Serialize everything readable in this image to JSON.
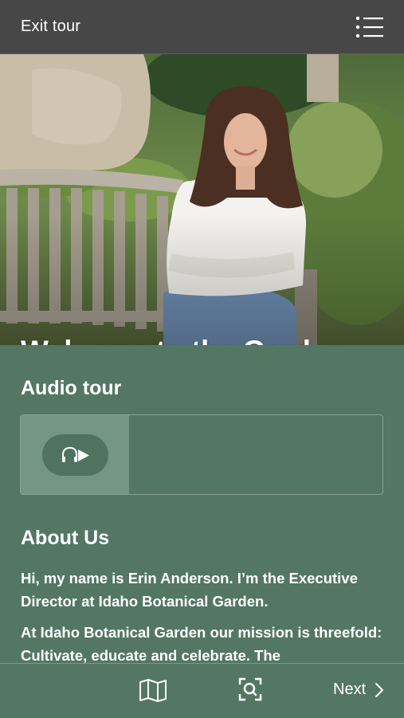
{
  "topbar": {
    "exit_label": "Exit tour",
    "menu_icon": "list-menu-icon"
  },
  "hero": {
    "title": "Welcome to the Garden",
    "image": "photo-woman-seated-on-garden-bench"
  },
  "audio": {
    "heading": "Audio tour",
    "play_icon": "headphones-play-icon"
  },
  "about": {
    "heading": "About Us",
    "paragraphs": [
      "Hi, my name is Erin Anderson. I’m the Executive Director at Idaho Botanical Garden.",
      "At Idaho Botanical Garden our mission is threefold: Cultivate, educate and celebrate. The"
    ]
  },
  "bottombar": {
    "map_icon": "map-icon",
    "scan_icon": "scan-search-icon",
    "next_label": "Next"
  },
  "colors": {
    "topbar": "#474747",
    "brand_green": "#537762",
    "thumb_green": "#759683",
    "text": "#ffffff"
  }
}
